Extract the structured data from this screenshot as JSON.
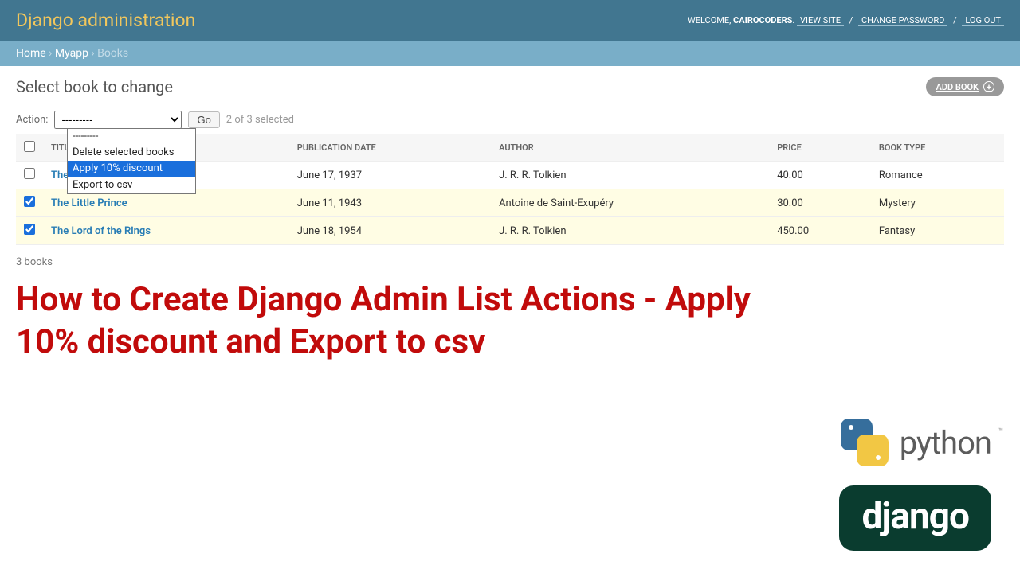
{
  "header": {
    "site_title": "Django administration",
    "welcome_prefix": "WELCOME, ",
    "username": "CAIROCODERS",
    "links": {
      "view_site": "VIEW SITE",
      "change_password": "CHANGE PASSWORD",
      "logout": "LOG OUT"
    }
  },
  "breadcrumbs": {
    "home": "Home",
    "app": "Myapp",
    "model": "Books",
    "sep": " › "
  },
  "page": {
    "title": "Select book to change",
    "add_button": "ADD BOOK"
  },
  "actions": {
    "label": "Action:",
    "selected_display": "---------",
    "options": [
      "---------",
      "Delete selected books",
      "Apply 10% discount",
      "Export to csv"
    ],
    "highlighted_index": 2,
    "go": "Go",
    "selection_count": "2 of 3 selected"
  },
  "table": {
    "columns": {
      "title": "TITLE",
      "pub": "PUBLICATION DATE",
      "author": "AUTHOR",
      "price": "PRICE",
      "type": "BOOK TYPE"
    },
    "rows": [
      {
        "checked": false,
        "title": "The …",
        "pub": "June 17, 1937",
        "author": "J. R. R. Tolkien",
        "price": "40.00",
        "type": "Romance"
      },
      {
        "checked": true,
        "title": "The Little Prince",
        "pub": "June 11, 1943",
        "author": "Antoine de Saint-Exupéry",
        "price": "30.00",
        "type": "Mystery"
      },
      {
        "checked": true,
        "title": "The Lord of the Rings",
        "pub": "June 18, 1954",
        "author": "J. R. R. Tolkien",
        "price": "450.00",
        "type": "Fantasy"
      }
    ],
    "footer_count": "3 books"
  },
  "overlay": {
    "headline": "How to Create Django Admin List Actions - Apply 10% discount and Export to csv",
    "python_label": "python",
    "python_tm": "™",
    "django_label": "django"
  }
}
